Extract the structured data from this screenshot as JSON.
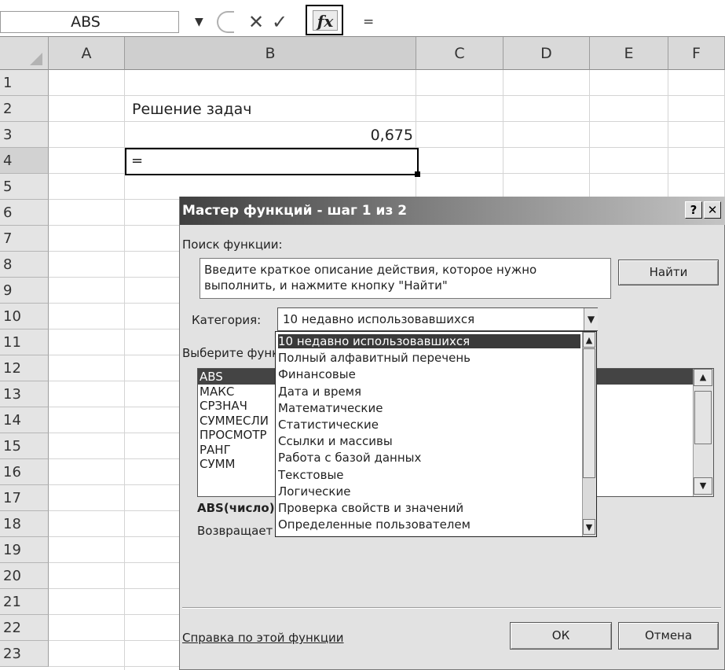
{
  "formula_bar": {
    "name_box": "ABS",
    "name_box_arrow": "▼",
    "cancel_symbol": "✕",
    "enter_symbol": "✓",
    "fx_label": "fx",
    "formula": "="
  },
  "sheet": {
    "columns": [
      "A",
      "B",
      "C",
      "D",
      "E",
      "F"
    ],
    "rows": [
      "1",
      "2",
      "3",
      "4",
      "5",
      "6",
      "7",
      "8",
      "9",
      "10",
      "11",
      "12",
      "13",
      "14",
      "15",
      "16",
      "17",
      "18",
      "19",
      "20",
      "21",
      "22",
      "23"
    ],
    "cells": {
      "b2": "Решение задач",
      "b3": "0,675",
      "b4": "="
    },
    "active_cell": "B4"
  },
  "dialog": {
    "title": "Мастер функций - шаг 1 из 2",
    "help_button": "?",
    "close_button": "✕",
    "search_label": "Поиск функции:",
    "search_value": "Введите краткое описание действия, которое нужно\nвыполнить, и нажмите кнопку \"Найти\"",
    "find_button": "Найти",
    "category_label": "Категория:",
    "category_value": "10 недавно использовавшихся",
    "functions_label": "Выберите функцию:",
    "functions": [
      "ABS",
      "МАКС",
      "СРЗНАЧ",
      "СУММЕСЛИ",
      "ПРОСМОТР",
      "РАНГ",
      "СУММ"
    ],
    "selected_function": "ABS",
    "syntax": "ABS(число)",
    "description": "Возвращает модуль (абсолютную величину) числа.",
    "help_link": "Справка по этой функции",
    "ok_button": "ОК",
    "cancel_button": "Отмена"
  },
  "category_dropdown": {
    "options": [
      "10 недавно использовавшихся",
      "Полный алфавитный перечень",
      "Финансовые",
      "Дата и время",
      "Математические",
      "Статистические",
      "Ссылки и массивы",
      "Работа с базой данных",
      "Текстовые",
      "Логические",
      "Проверка свойств и значений",
      "Определенные пользователем"
    ],
    "selected_index": 0,
    "scroll_up": "▲",
    "scroll_down": "▼"
  },
  "colors": {
    "selection": "#3a3a3a",
    "dialog_bg": "#e2e2e2",
    "header_bg": "#d9d9d9"
  }
}
